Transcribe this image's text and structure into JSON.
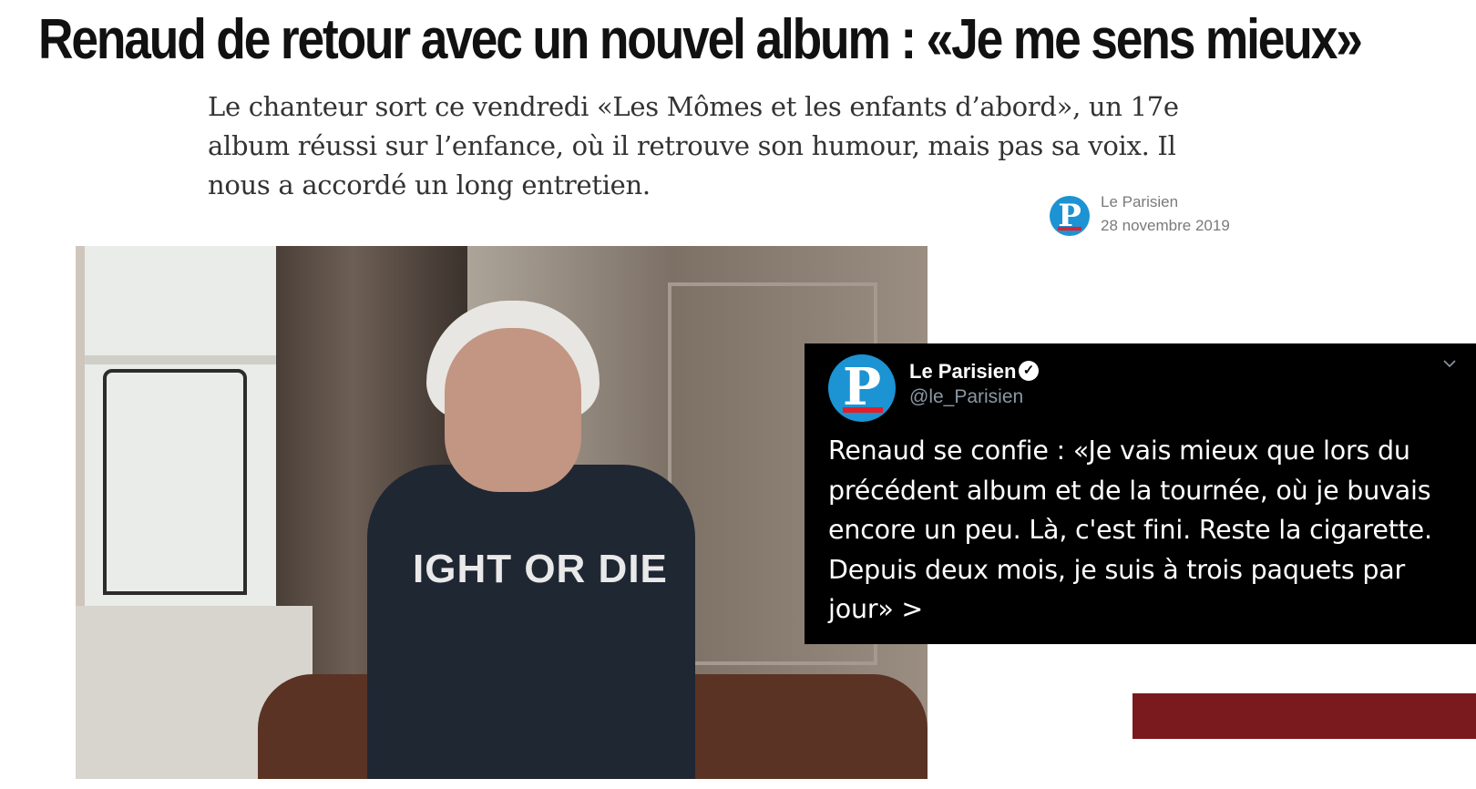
{
  "article": {
    "headline": "Renaud de retour avec un nouvel album : «Je me sens mieux»",
    "standfirst": "Le chanteur sort ce vendredi «Les Mômes et les enfants d’abord», un 17e album réussi sur l’enfance, où il retrouve son humour, mais pas sa voix. Il nous a accordé un long entretien.",
    "source": {
      "name": "Le Parisien",
      "date": "28 novembre 2019",
      "logo_letter": "P"
    },
    "photo": {
      "shirt_text": "IGHT OR DIE"
    }
  },
  "tweet": {
    "name": "Le Parisien",
    "handle": "@le_Parisien",
    "avatar_letter": "P",
    "verified_mark": "✓",
    "text": "Renaud se confie : «Je vais mieux que lors du précédent album et de la tournée, où je buvais encore un peu. Là, c'est fini. Reste la cigarette. Depuis deux mois, je suis à trois paquets par jour» >"
  },
  "colors": {
    "brand_blue": "#1c93d3",
    "brand_red": "#e0202a",
    "bottom_bar": "#7a1a1e"
  }
}
